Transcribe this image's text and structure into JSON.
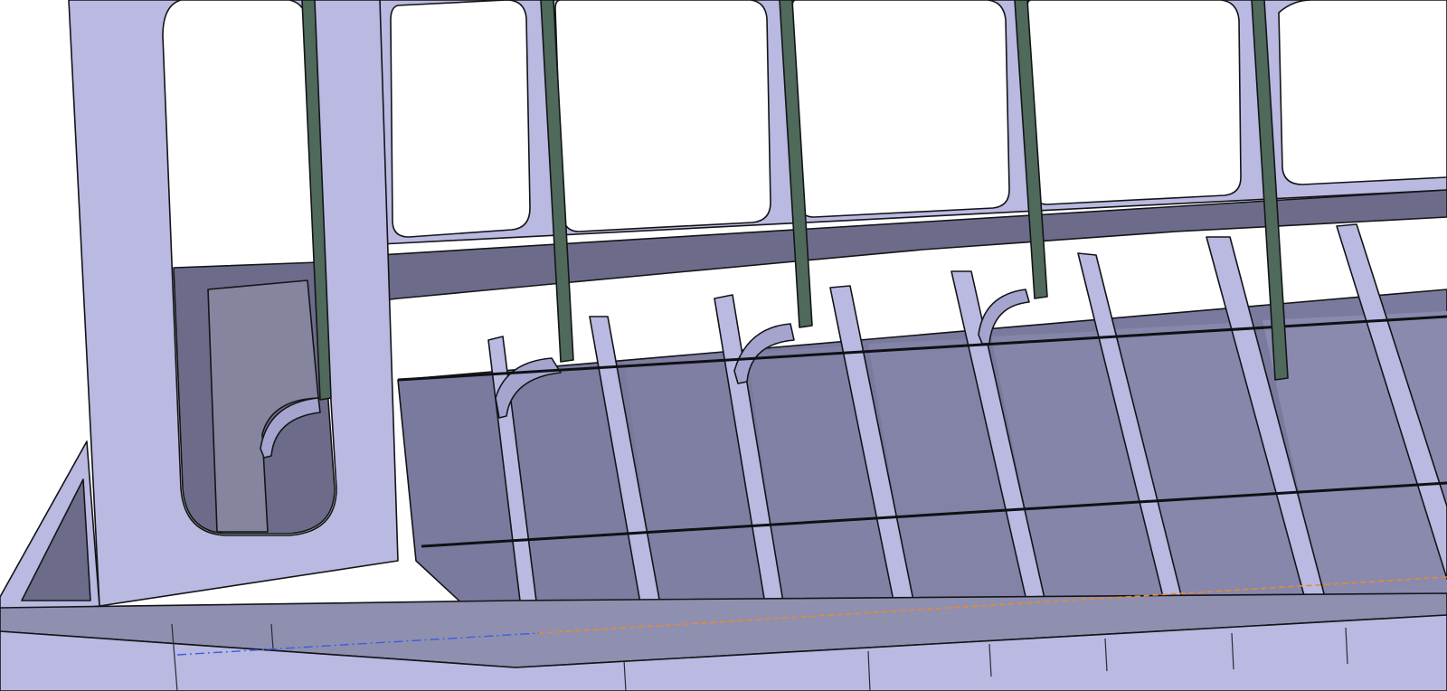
{
  "viewport": {
    "content": "3d-model-render",
    "colors": {
      "background": "#ffffff",
      "plate_light": "#b9b9e1",
      "plate_mid": "#9b9bc9",
      "plate_shadow": "#6c6c8a",
      "panel_face": "#7f7fa3",
      "panel_face_dark": "#727297",
      "stiffener_green": "#4f6a5a",
      "edge_line": "#141418",
      "dashed_orange": "#e58a34",
      "dashed_blue": "#3a5ee0"
    },
    "icons": {
      "cutout": "rounded-rect-cutout",
      "stiffener": "vertical-green-stiffener"
    }
  }
}
